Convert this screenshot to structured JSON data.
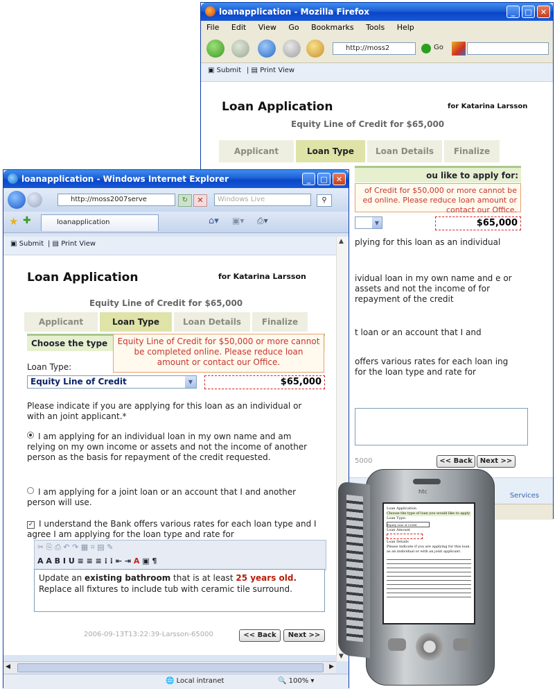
{
  "firefox": {
    "title": "loanapplication - Mozilla Firefox",
    "menu": [
      "File",
      "Edit",
      "View",
      "Go",
      "Bookmarks",
      "Tools",
      "Help"
    ],
    "address": "http://moss2",
    "go_label": "Go",
    "submit": "Submit",
    "print_view": "Print View",
    "page_title": "Loan Application",
    "for_name": "for Katarina Larsson",
    "subheading": "Equity Line of Credit for $65,000",
    "tabs": [
      "Applicant",
      "Loan Type",
      "Loan Details",
      "Finalize"
    ],
    "section_head": "ou like to apply for:",
    "warning": "of Credit for $50,000 or more cannot be ed online. Please reduce loan amount or contact our Office.",
    "amount": "$65,000",
    "frag1": "plying for this loan as an individual",
    "frag2": "ividual loan in my own name and e or assets and not the income of for repayment of the credit",
    "frag3": "t loan or an account that I and",
    "frag4": "offers various rates for each loan ing for the loan type and rate for",
    "footer_id": "5000",
    "back": "<< Back",
    "next": "Next >>",
    "status_right": "Services"
  },
  "ie": {
    "title": "loanapplication - Windows Internet Explorer",
    "address": "http://moss2007serve",
    "search_placeholder": "Windows Live",
    "tab_label": "loanapplication",
    "submit": "Submit",
    "print_view": "Print View",
    "page_title": "Loan Application",
    "for_name": "for Katarina Larsson",
    "subheading": "Equity Line of Credit for $65,000",
    "tabs": [
      "Applicant",
      "Loan Type",
      "Loan Details",
      "Finalize"
    ],
    "section_head": "Choose the type",
    "warning": "Equity Line of Credit for $50,000 or more cannot be completed online. Please reduce loan amount or contact our Office.",
    "loan_type_label": "Loan Type:",
    "loan_type_value": "Equity Line of Credit",
    "amount": "$65,000",
    "question": "Please indicate if you are applying for this loan as an individual or with an joint applicant.*",
    "option_individual": "I am applying for an individual loan in my own name and am relying on my own income or assets and not the income of another person as the basis for repayment of the credit requested.",
    "option_joint": "I am applying for a joint loan or an account that I and another person will use.",
    "checkbox_text": "I understand the Bank offers various rates for each loan type and I agree I am applying for the loan type and rate for",
    "rte_text_1": "Update an ",
    "rte_bold_1": "existing bathroom",
    "rte_text_2": " that is at least ",
    "rte_red_1": "25 years old.",
    "rte_text_3": " Replace all fixtures to include tub with ceramic tile surround.",
    "footer_id": "2006-09-13T13:22:39-Larsson-65000",
    "back": "<< Back",
    "next": "Next >>",
    "zone": "Local intranet",
    "zoom": "100%"
  },
  "phone": {
    "brand": "htc",
    "screen_lines": [
      "Loan Application",
      "Choose the type of loan you would like to apply",
      "Loan Type:",
      "Equity Line of Credit",
      "Loan Amount",
      "Loan Details",
      "Please indicate if you are applying for this loan as an individual or with an joint applicant."
    ]
  },
  "colors": {
    "xp_blue": "#0a46c8",
    "tab_active": "#dfe3a8",
    "section": "#e6f0ce",
    "warning_text": "#c8352a"
  }
}
